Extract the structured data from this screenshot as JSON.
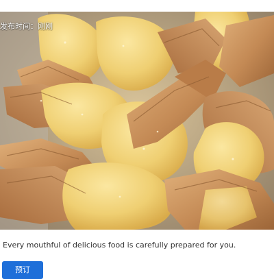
{
  "post": {
    "publish_time": "发布时间：刚刚",
    "image_subject": "fried-wontons-photo",
    "description": "Every mouthful of delicious food is carefully prepared for you.",
    "book_button_label": "预订"
  },
  "colors": {
    "button_bg": "#1e6fd9",
    "button_text": "#ffffff",
    "description_text": "#333333",
    "wonton_fill": "#f0d27a",
    "wonton_crisp": "#c98f55"
  }
}
